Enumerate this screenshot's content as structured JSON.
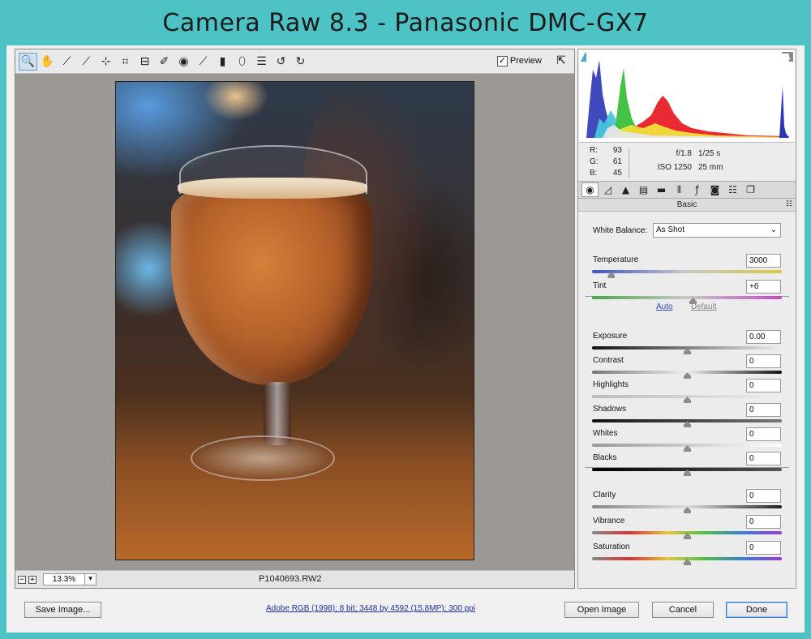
{
  "window": {
    "title": "Camera Raw 8.3  -  Panasonic DMC-GX7"
  },
  "toolbar": {
    "tools": [
      {
        "icon": "zoom-icon",
        "glyph": "🔍"
      },
      {
        "icon": "hand-icon",
        "glyph": "✋"
      },
      {
        "icon": "white-balance-icon",
        "glyph": "⟋"
      },
      {
        "icon": "color-sampler-icon",
        "glyph": "⟋"
      },
      {
        "icon": "targeted-adjustment-icon",
        "glyph": "⊹"
      },
      {
        "icon": "crop-icon",
        "glyph": "⌗"
      },
      {
        "icon": "straighten-icon",
        "glyph": "⊟"
      },
      {
        "icon": "spot-removal-icon",
        "glyph": "✐"
      },
      {
        "icon": "red-eye-icon",
        "glyph": "◉"
      },
      {
        "icon": "adjustment-brush-icon",
        "glyph": "⟋"
      },
      {
        "icon": "graduated-filter-icon",
        "glyph": "▮"
      },
      {
        "icon": "radial-filter-icon",
        "glyph": "⬯"
      },
      {
        "icon": "preferences-icon",
        "glyph": "☰"
      },
      {
        "icon": "rotate-ccw-icon",
        "glyph": "↺"
      },
      {
        "icon": "rotate-cw-icon",
        "glyph": "↻"
      }
    ],
    "preview_label": "Preview",
    "preview_checked": "✓"
  },
  "status": {
    "zoom": "13.3%",
    "filename": "P1040693.RW2",
    "minus": "−",
    "plus": "+"
  },
  "histogram": {
    "r": {
      "label": "R:",
      "value": "93"
    },
    "g": {
      "label": "G:",
      "value": "61"
    },
    "b": {
      "label": "B:",
      "value": "45"
    },
    "aperture": "f/1.8",
    "shutter": "1/25 s",
    "iso": "ISO 1250",
    "focal": "25 mm"
  },
  "panel": {
    "tabs": [
      "basic-icon",
      "tone-curve-icon",
      "detail-icon",
      "hsl-icon",
      "split-toning-icon",
      "lens-corrections-icon",
      "effects-icon",
      "camera-calibration-icon",
      "presets-icon",
      "snapshots-icon"
    ],
    "title": "Basic",
    "white_balance_label": "White Balance:",
    "white_balance_value": "As Shot",
    "auto": "Auto",
    "default": "Default",
    "sliders": [
      {
        "label": "Temperature",
        "value": "3000",
        "pos": 0.1
      },
      {
        "label": "Tint",
        "value": "+6",
        "pos": 0.53
      },
      {
        "label": "Exposure",
        "value": "0.00",
        "pos": 0.5
      },
      {
        "label": "Contrast",
        "value": "0",
        "pos": 0.5
      },
      {
        "label": "Highlights",
        "value": "0",
        "pos": 0.5
      },
      {
        "label": "Shadows",
        "value": "0",
        "pos": 0.5
      },
      {
        "label": "Whites",
        "value": "0",
        "pos": 0.5
      },
      {
        "label": "Blacks",
        "value": "0",
        "pos": 0.5
      },
      {
        "label": "Clarity",
        "value": "0",
        "pos": 0.5
      },
      {
        "label": "Vibrance",
        "value": "0",
        "pos": 0.5
      },
      {
        "label": "Saturation",
        "value": "0",
        "pos": 0.5
      }
    ]
  },
  "bottom": {
    "save": "Save Image...",
    "workflow": "Adobe RGB (1998); 8 bit; 3448 by 4592 (15.8MP); 300 ppi",
    "open": "Open Image",
    "cancel": "Cancel",
    "done": "Done"
  }
}
